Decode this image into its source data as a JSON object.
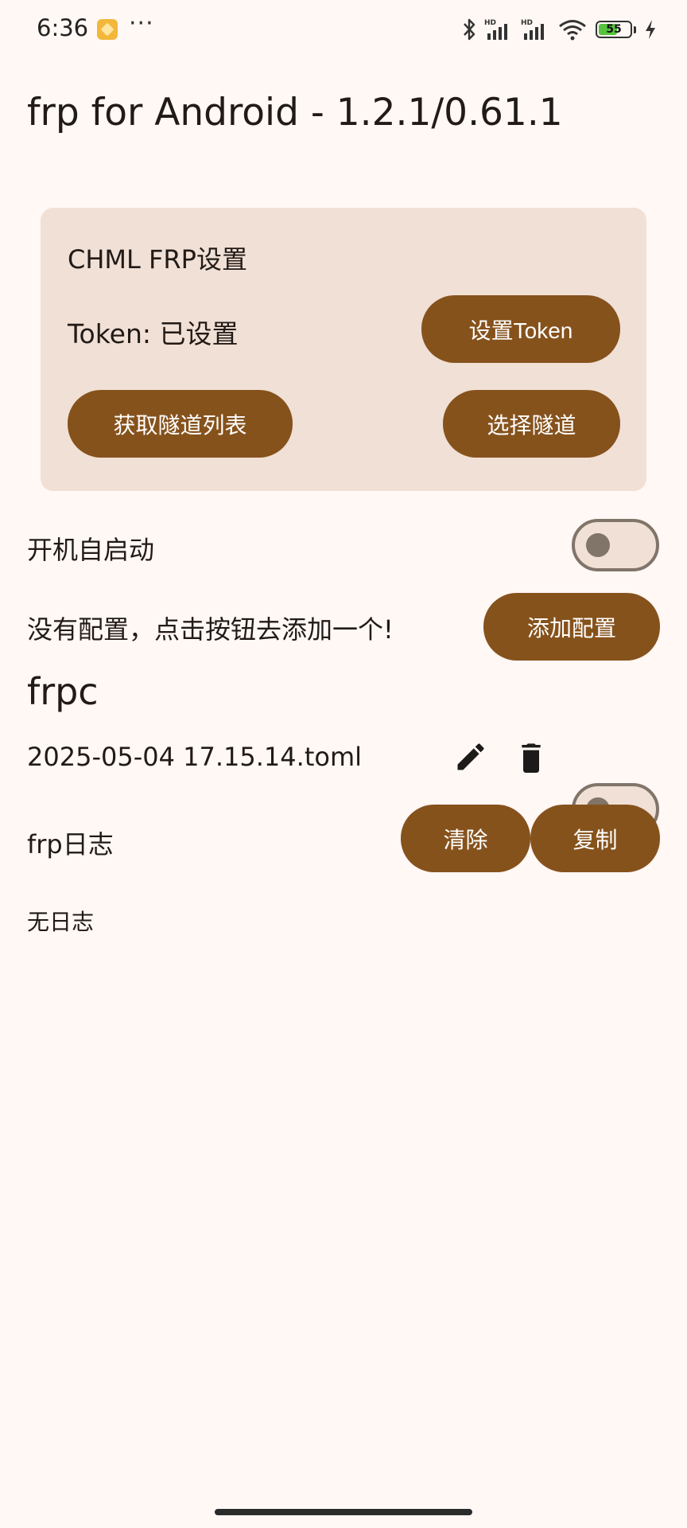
{
  "status_bar": {
    "time": "6:36",
    "more": "···",
    "battery": "55",
    "icons": [
      "notification-app-icon",
      "bluetooth-icon",
      "signal-hd-1-icon",
      "signal-hd-2-icon",
      "wifi-icon",
      "battery-icon",
      "charging-bolt-icon"
    ]
  },
  "app": {
    "title": "frp for Android - 1.2.1/0.61.1"
  },
  "chml_card": {
    "title": "CHML FRP设置",
    "token_status": "Token: 已设置",
    "set_token_label": "设置Token",
    "get_tunnels_label": "获取隧道列表",
    "select_tunnel_label": "选择隧道"
  },
  "autostart": {
    "label": "开机自启动",
    "enabled": false
  },
  "config": {
    "empty_message": "没有配置，点击按钮去添加一个!",
    "add_label": "添加配置"
  },
  "frpc": {
    "header": "frpc",
    "file_name": "2025-05-04 17.15.14.toml",
    "enabled": false
  },
  "log": {
    "label": "frp日志",
    "clear_label": "清除",
    "copy_label": "复制",
    "content": "无日志"
  },
  "colors": {
    "background": "#fff8f5",
    "card": "#f0e0d6",
    "accent": "#86521c",
    "outline": "#817469"
  }
}
